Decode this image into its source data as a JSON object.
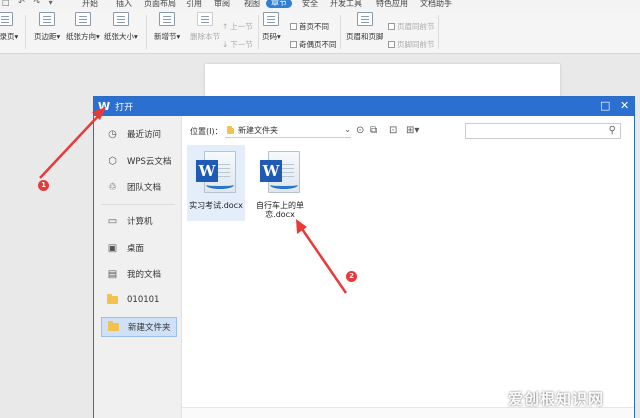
{
  "menubar": {
    "tabs": [
      {
        "label": "开始",
        "active": false
      },
      {
        "label": "插入",
        "active": false
      },
      {
        "label": "页面布局",
        "active": false
      },
      {
        "label": "引用",
        "active": false
      },
      {
        "label": "审阅",
        "active": false
      },
      {
        "label": "视图",
        "active": false
      },
      {
        "label": "章节",
        "active": true
      },
      {
        "label": "安全",
        "active": false
      },
      {
        "label": "开发工具",
        "active": false
      },
      {
        "label": "特色应用",
        "active": false
      },
      {
        "label": "文档助手",
        "active": false
      }
    ]
  },
  "ribbon": {
    "toc_page": "目录页▾",
    "margins": "页边距▾",
    "orientation": "纸张方向▾",
    "paper_size": "纸张大小▾",
    "new_section": "新增节▾",
    "delete_section": "删除本节",
    "prev_section": "上一节",
    "next_section": "下一节",
    "page_number": "页码▾",
    "first_page_diff": "首页不同",
    "odd_even_diff": "奇偶页不同",
    "header_footer": "页眉和页脚",
    "same_as_prev_header": "页眉同前节",
    "same_as_prev_footer": "页脚同前节"
  },
  "dialog": {
    "logo": "W",
    "title": "打开",
    "sidebar": [
      {
        "label": "最近访问",
        "icon": "clock-icon"
      },
      {
        "label": "WPS云文档",
        "icon": "cloud-doc-icon"
      },
      {
        "label": "团队文档",
        "icon": "team-icon"
      },
      {
        "label": "计算机",
        "icon": "computer-icon"
      },
      {
        "label": "桌面",
        "icon": "desktop-icon"
      },
      {
        "label": "我的文档",
        "icon": "my-documents-icon"
      },
      {
        "label": "010101",
        "icon": "folder-icon"
      },
      {
        "label": "新建文件夹",
        "icon": "folder-icon",
        "active": true
      }
    ],
    "location_label": "位置(I)：",
    "location_value": "新建文件夹",
    "search_placeholder": "",
    "files": [
      {
        "name": "实习考试.docx",
        "selected": true
      },
      {
        "name": "自行车上的单恋.docx",
        "selected": false
      }
    ]
  },
  "annotations": [
    "1",
    "2"
  ],
  "watermark": "爱创根知识网",
  "colors": {
    "titlebar": "#2b6fd1",
    "active_tab": "#2f7fd8",
    "annotation": "#e83a3a",
    "word_icon": "#1f5bb5"
  }
}
